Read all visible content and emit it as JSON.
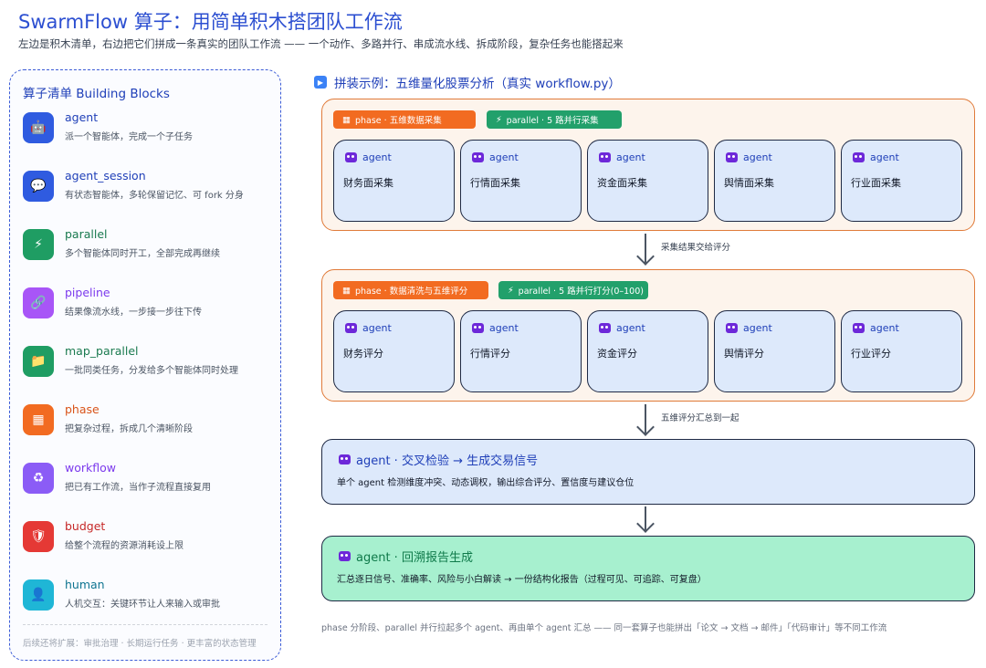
{
  "header": {
    "title": "SwarmFlow 算子：用简单积木搭团队工作流",
    "subtitle": "左边是积木清单，右边把它们拼成一条真实的团队工作流 —— 一个动作、多路并行、串成流水线、拆成阶段，复杂任务也能搭起来"
  },
  "sidebar": {
    "title": "算子清单 Building Blocks",
    "blocks": [
      {
        "name": "agent",
        "desc": "派一个智能体，完成一个子任务",
        "icon": "robot-icon",
        "color": "#2f5be0",
        "name_color": "#1f3fb8"
      },
      {
        "name": "agent_session",
        "desc": "有状态智能体，多轮保留记忆、可 fork 分身",
        "icon": "speech-bubble-icon",
        "color": "#2f5be0",
        "name_color": "#1f3fb8"
      },
      {
        "name": "parallel",
        "desc": "多个智能体同时开工，全部完成再继续",
        "icon": "lightning-icon",
        "color": "#1f9d63",
        "name_color": "#1a7a4f"
      },
      {
        "name": "pipeline",
        "desc": "结果像流水线，一步接一步往下传",
        "icon": "chain-link-icon",
        "color": "#a855f7",
        "name_color": "#7c3aed"
      },
      {
        "name": "map_parallel",
        "desc": "一批同类任务，分发给多个智能体同时处理",
        "icon": "folder-icon",
        "color": "#1f9d63",
        "name_color": "#1a7a4f"
      },
      {
        "name": "phase",
        "desc": "把复杂过程，拆成几个清晰阶段",
        "icon": "building-blocks-icon",
        "color": "#f26b21",
        "name_color": "#d9541a"
      },
      {
        "name": "workflow",
        "desc": "把已有工作流，当作子流程直接复用",
        "icon": "recycle-icon",
        "color": "#8b5cf6",
        "name_color": "#7c3aed"
      },
      {
        "name": "budget",
        "desc": "给整个流程的资源消耗设上限",
        "icon": "shield-icon",
        "color": "#e53935",
        "name_color": "#c62828"
      },
      {
        "name": "human",
        "desc": "人机交互：关键环节让人来输入或审批",
        "icon": "person-icon",
        "color": "#1fb6d6",
        "name_color": "#0e7490"
      }
    ],
    "footer": "后续还将扩展：审批治理 · 长期运行任务 · 更丰富的状态管理"
  },
  "example": {
    "title": "拼装示例：五维量化股票分析（真实 workflow.py）",
    "phase1": {
      "phase_tag": "phase · 五维数据采集",
      "parallel_tag": "parallel · 5 路并行采集",
      "agents": [
        {
          "head": "agent",
          "label": "财务面采集"
        },
        {
          "head": "agent",
          "label": "行情面采集"
        },
        {
          "head": "agent",
          "label": "资金面采集"
        },
        {
          "head": "agent",
          "label": "舆情面采集"
        },
        {
          "head": "agent",
          "label": "行业面采集"
        }
      ]
    },
    "arrow1_label": "采集结果交给评分",
    "phase2": {
      "phase_tag": "phase · 数据清洗与五维评分",
      "parallel_tag": "parallel · 5 路并行打分(0–100)",
      "agents": [
        {
          "head": "agent",
          "label": "财务评分"
        },
        {
          "head": "agent",
          "label": "行情评分"
        },
        {
          "head": "agent",
          "label": "资金评分"
        },
        {
          "head": "agent",
          "label": "舆情评分"
        },
        {
          "head": "agent",
          "label": "行业评分"
        }
      ]
    },
    "arrow2_label": "五维评分汇总到一起",
    "signal": {
      "title": "agent · 交叉检验 → 生成交易信号",
      "desc": "单个 agent 检测维度冲突、动态调权，输出综合评分、置信度与建议仓位"
    },
    "report": {
      "title": "agent · 回溯报告生成",
      "desc": "汇总逐日信号、准确率、风险与小白解读 → 一份结构化报告（过程可见、可追踪、可复盘）"
    },
    "note": "phase 分阶段、parallel 并行拉起多个 agent、再由单个 agent 汇总 —— 同一套算子也能拼出「论文 → 文档 → 邮件」「代码审计」等不同工作流"
  }
}
